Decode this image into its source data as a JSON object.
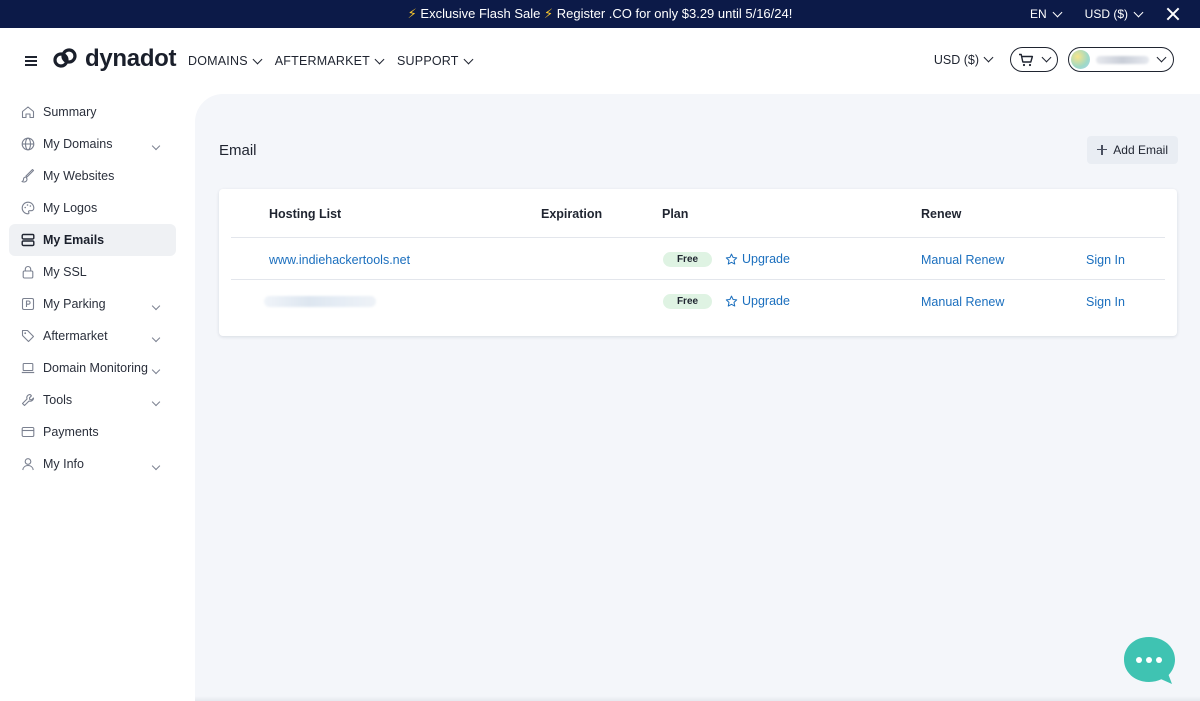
{
  "promo": {
    "bolt_left": "⚡",
    "text_part1": "Exclusive Flash Sale",
    "bolt_mid": "⚡",
    "text_part2": "Register .CO for only $3.29 until 5/16/24!",
    "language": "EN",
    "currency": "USD ($)"
  },
  "header": {
    "logo_text": "dynadot",
    "nav": [
      {
        "label": "DOMAINS"
      },
      {
        "label": "AFTERMARKET"
      },
      {
        "label": "SUPPORT"
      }
    ],
    "currency": "USD ($)"
  },
  "sidebar": {
    "items": [
      {
        "label": "Summary",
        "icon": "home-icon"
      },
      {
        "label": "My Domains",
        "icon": "globe-icon",
        "expandable": true
      },
      {
        "label": "My Websites",
        "icon": "brush-icon"
      },
      {
        "label": "My Logos",
        "icon": "palette-icon"
      },
      {
        "label": "My Emails",
        "icon": "server-icon",
        "active": true
      },
      {
        "label": "My SSL",
        "icon": "lock-icon"
      },
      {
        "label": "My Parking",
        "icon": "parking-icon",
        "expandable": true
      },
      {
        "label": "Aftermarket",
        "icon": "tag-icon",
        "expandable": true
      },
      {
        "label": "Domain Monitoring",
        "icon": "laptop-icon",
        "expandable": true
      },
      {
        "label": "Tools",
        "icon": "wrench-icon",
        "expandable": true
      },
      {
        "label": "Payments",
        "icon": "card-icon"
      },
      {
        "label": "My Info",
        "icon": "user-icon",
        "expandable": true
      }
    ]
  },
  "main": {
    "title": "Email",
    "add_button": "Add Email",
    "table": {
      "headers": {
        "hosting": "Hosting List",
        "expiration": "Expiration",
        "plan": "Plan",
        "renew": "Renew"
      },
      "rows": [
        {
          "hosting": "www.indiehackertools.net",
          "plan": "Free",
          "upgrade": "Upgrade",
          "renew": "Manual Renew",
          "sign_in": "Sign In"
        },
        {
          "hosting": "",
          "plan": "Free",
          "upgrade": "Upgrade",
          "renew": "Manual Renew",
          "sign_in": "Sign In"
        }
      ]
    }
  },
  "colors": {
    "banner_bg": "#0c1a48",
    "link": "#1b6fbe",
    "badge_bg": "#dff3e3",
    "chat_bubble": "#3fc3b2",
    "main_bg": "#f4f6fa"
  }
}
